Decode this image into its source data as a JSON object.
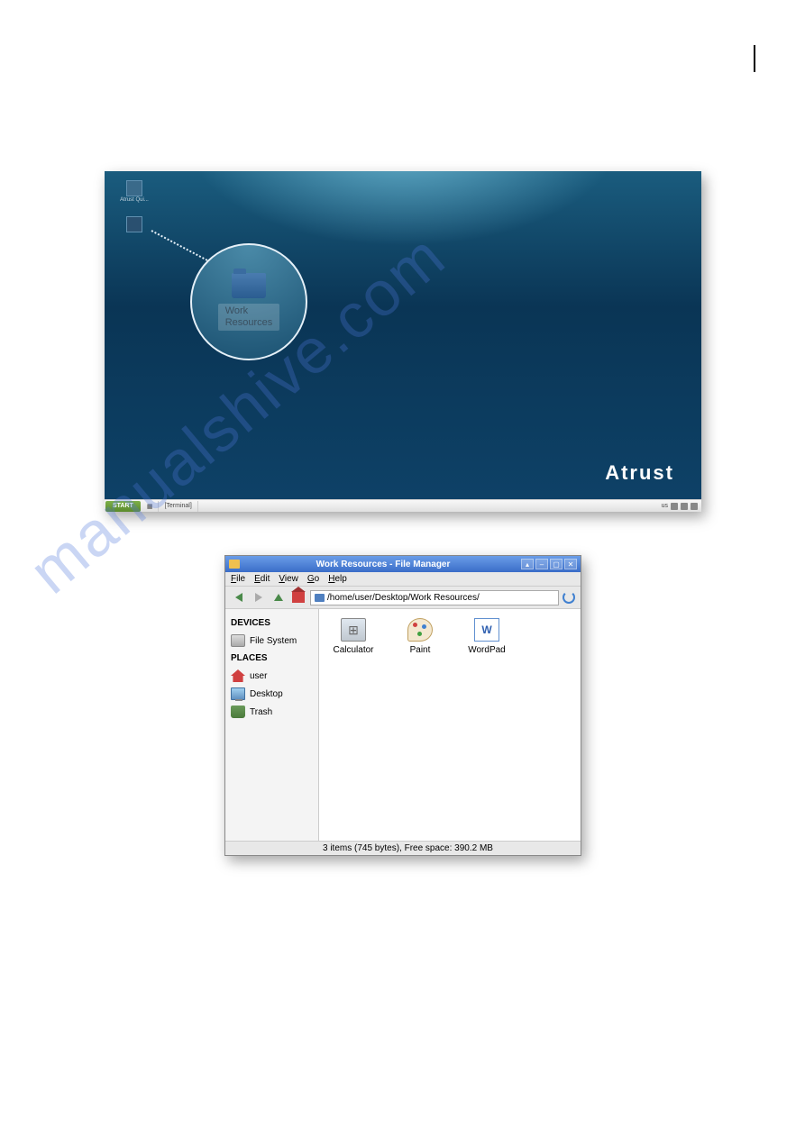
{
  "watermark": "manualshive.com",
  "desktop": {
    "icons": [
      {
        "label": "Atrust Qui..."
      },
      {
        "label": "Work Resources"
      }
    ],
    "magnifier": {
      "label_line1": "Work",
      "label_line2": "Resources"
    },
    "brand": "Atrust",
    "taskbar": {
      "start": "START",
      "item": "[Terminal]",
      "locale": "us"
    }
  },
  "filemgr": {
    "title": "Work Resources - File Manager",
    "menu": {
      "file": "File",
      "edit": "Edit",
      "view": "View",
      "go": "Go",
      "help": "Help"
    },
    "path": "/home/user/Desktop/Work Resources/",
    "sidebar": {
      "devices_header": "DEVICES",
      "filesystem": "File System",
      "places_header": "PLACES",
      "user": "user",
      "desktop": "Desktop",
      "trash": "Trash"
    },
    "files": [
      {
        "name": "Calculator"
      },
      {
        "name": "Paint"
      },
      {
        "name": "WordPad"
      }
    ],
    "status": "3 items (745 bytes), Free space: 390.2 MB"
  }
}
